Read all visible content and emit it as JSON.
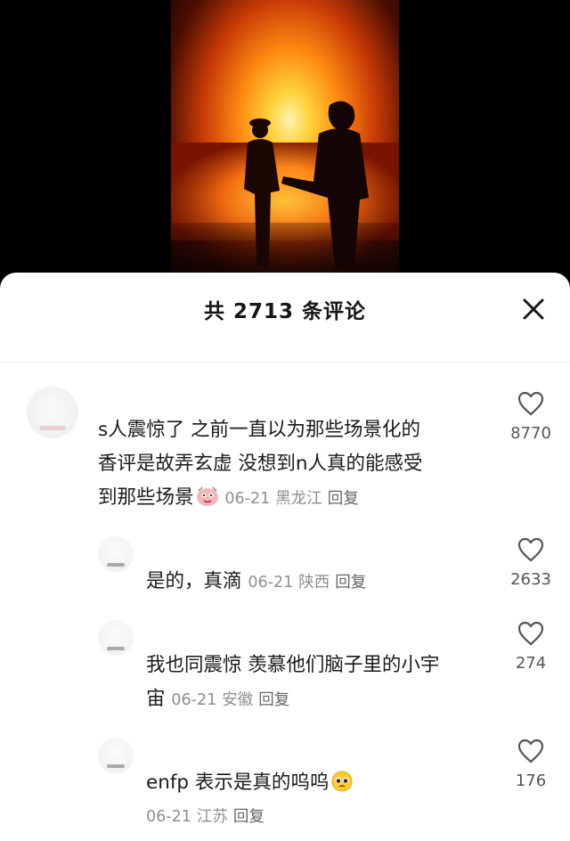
{
  "sheet": {
    "title": "共 2713 条评论"
  },
  "comments": [
    {
      "lines": [
        "s人震惊了  之前一直以为那些场景化的",
        "香评是故弄玄虚  没想到n人真的能感受",
        "到那些场景"
      ],
      "emoji": "sticker-face",
      "date": "06-21",
      "location": "黑龙江",
      "reply": "回复",
      "likes": "8770"
    }
  ],
  "replies": [
    {
      "lines": [
        "是的，真滴"
      ],
      "date": "06-21",
      "location": "陕西",
      "reply": "回复",
      "likes": "2633"
    },
    {
      "lines": [
        "我也同震惊 羡慕他们脑子里的小宇",
        "宙"
      ],
      "date": "06-21",
      "location": "安徽",
      "reply": "回复",
      "likes": "274"
    },
    {
      "lines": [
        "enfp 表示是真的呜呜"
      ],
      "emoji": "pleading-face",
      "date": "06-21",
      "location": "江苏",
      "reply": "回复",
      "likes": "176"
    }
  ],
  "icons": {
    "close": "close-icon",
    "like": "heart-icon"
  },
  "colors": {
    "sheet_bg": "#ffffff",
    "meta_text": "#8f8f8f",
    "body_text": "#1a1a1a"
  }
}
